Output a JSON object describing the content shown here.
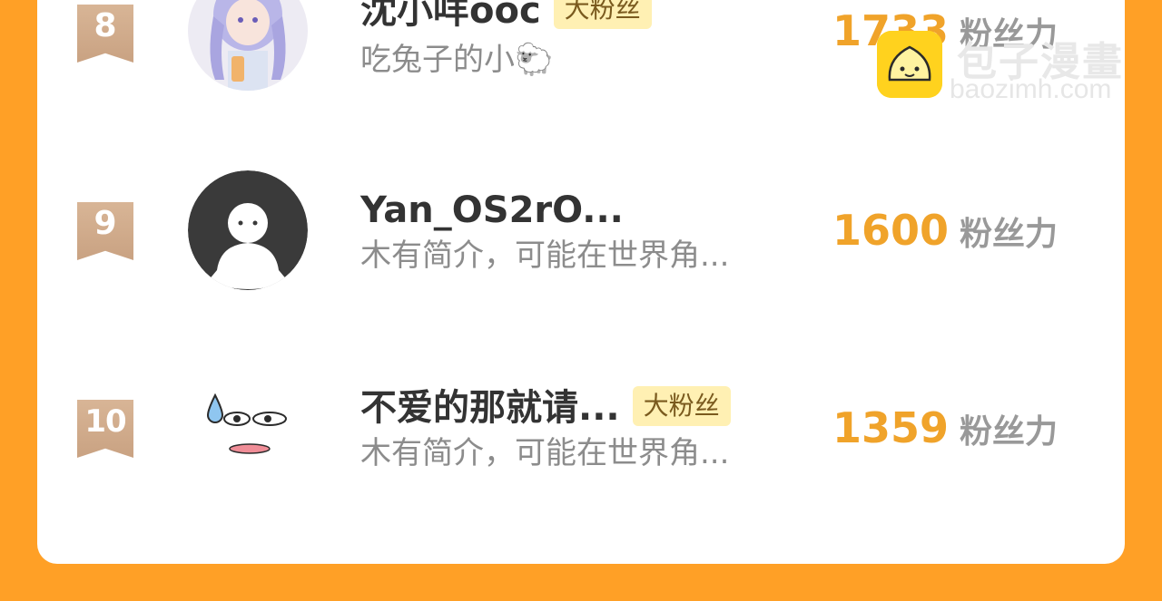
{
  "rows": [
    {
      "rank": "8",
      "name": "沈小咩ooc",
      "badge": "大粉丝",
      "desc": "吃兔子的小🐑",
      "score": "1733",
      "unit": "粉丝力",
      "avatar_icon": "anime-girl-avatar"
    },
    {
      "rank": "9",
      "name": "Yan_OS2rO...",
      "badge": "",
      "desc": "木有简介，可能在世界角...",
      "score": "1600",
      "unit": "粉丝力",
      "avatar_icon": "default-person-avatar"
    },
    {
      "rank": "10",
      "name": "不爱的那就请...",
      "badge": "大粉丝",
      "desc": "木有简介，可能在世界角...",
      "score": "1359",
      "unit": "粉丝力",
      "avatar_icon": "sweat-face-avatar"
    }
  ],
  "watermark": {
    "cn": "包子漫畫",
    "url": "baozimh.com"
  },
  "colors": {
    "background": "#FFA026",
    "score": "#F0A32A",
    "badge_bg": "#FFF0B3",
    "rank_ribbon": "#C9A282"
  }
}
